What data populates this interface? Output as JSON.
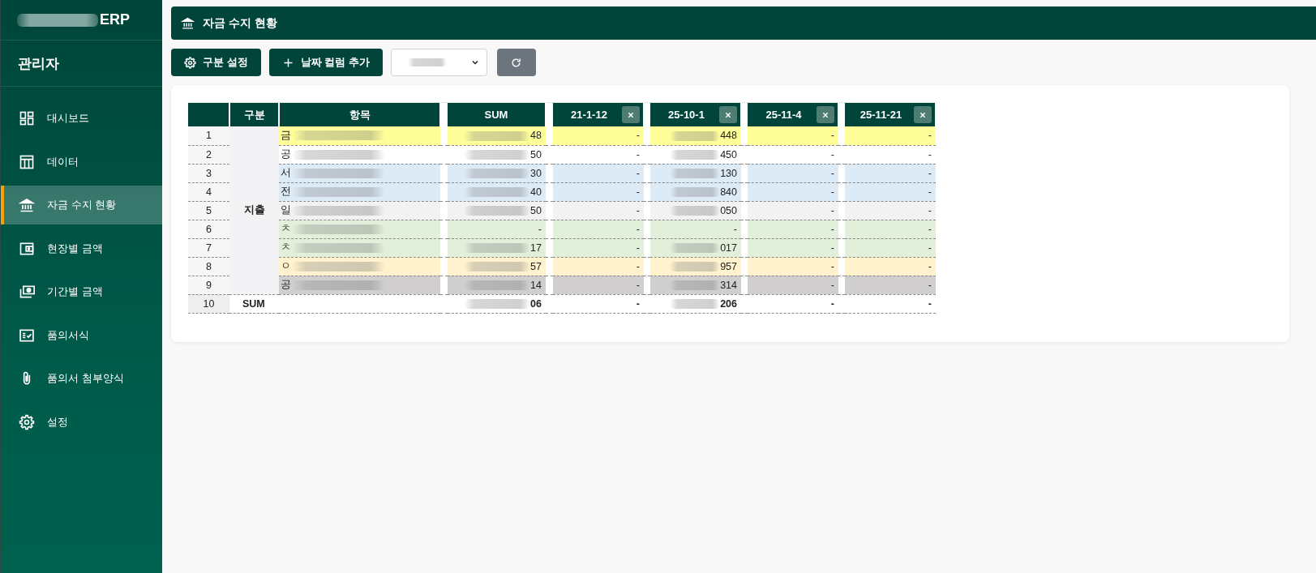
{
  "sidebar": {
    "brand": "ERP",
    "user": "관리자",
    "items": [
      {
        "label": "대시보드",
        "selected": false
      },
      {
        "label": "데이터",
        "selected": false
      },
      {
        "label": "자금 수지 현황",
        "selected": true
      },
      {
        "label": "현장별 금액",
        "selected": false
      },
      {
        "label": "기간별 금액",
        "selected": false
      },
      {
        "label": "품의서식",
        "selected": false
      },
      {
        "label": "품의서 첨부양식",
        "selected": false
      },
      {
        "label": "설정",
        "selected": false
      }
    ]
  },
  "header": {
    "title": "자금 수지 현황"
  },
  "toolbar": {
    "buttons": [
      {
        "kind": "settings",
        "label": "구분 설정"
      },
      {
        "kind": "add",
        "label": "날짜 컬럼 추가"
      }
    ]
  },
  "table": {
    "columns": [
      "구분",
      "항목",
      "SUM"
    ],
    "date_columns": [
      "21-1-12",
      "25-10-1",
      "25-11-4",
      "25-11-21"
    ],
    "group": "지출",
    "rows": [
      {
        "number": "1",
        "color": "#ffff99",
        "item": {
          "text": "금",
          "blurred": true
        },
        "sum": {
          "text": "48",
          "blurred": true
        },
        "values": [
          {
            "text": "-",
            "blurred": false
          },
          {
            "text": "448",
            "blurred": true
          },
          {
            "text": "-",
            "blurred": false
          },
          {
            "text": "-",
            "blurred": false
          }
        ]
      },
      {
        "number": "2",
        "color": "#ffffff",
        "item": {
          "text": "공",
          "blurred": true
        },
        "sum": {
          "text": "50",
          "blurred": true
        },
        "values": [
          {
            "text": "-",
            "blurred": false
          },
          {
            "text": "450",
            "blurred": true
          },
          {
            "text": "-",
            "blurred": false
          },
          {
            "text": "-",
            "blurred": false
          }
        ]
      },
      {
        "number": "3",
        "color": "#ddebf7",
        "item": {
          "text": "서",
          "blurred": true
        },
        "sum": {
          "text": "30",
          "blurred": true
        },
        "values": [
          {
            "text": "-",
            "blurred": false
          },
          {
            "text": "130",
            "blurred": true
          },
          {
            "text": "-",
            "blurred": false
          },
          {
            "text": "-",
            "blurred": false
          }
        ]
      },
      {
        "number": "4",
        "color": "#ddebf7",
        "item": {
          "text": "전",
          "blurred": true
        },
        "sum": {
          "text": "40",
          "blurred": true
        },
        "values": [
          {
            "text": "-",
            "blurred": false
          },
          {
            "text": "840",
            "blurred": true
          },
          {
            "text": "-",
            "blurred": false
          },
          {
            "text": "-",
            "blurred": false
          }
        ]
      },
      {
        "number": "5",
        "color": "#f2f2f2",
        "item": {
          "text": "일",
          "blurred": true
        },
        "sum": {
          "text": "50",
          "blurred": true
        },
        "values": [
          {
            "text": "-",
            "blurred": false
          },
          {
            "text": "050",
            "blurred": true
          },
          {
            "text": "-",
            "blurred": false
          },
          {
            "text": "-",
            "blurred": false
          }
        ]
      },
      {
        "number": "6",
        "color": "#e2efda",
        "item": {
          "text": "ㅊ",
          "blurred": true
        },
        "sum": {
          "text": "-",
          "blurred": false
        },
        "values": [
          {
            "text": "-",
            "blurred": false
          },
          {
            "text": "-",
            "blurred": false
          },
          {
            "text": "-",
            "blurred": false
          },
          {
            "text": "-",
            "blurred": false
          }
        ]
      },
      {
        "number": "7",
        "color": "#e2efda",
        "item": {
          "text": "ㅊ",
          "blurred": true
        },
        "sum": {
          "text": "17",
          "blurred": true
        },
        "values": [
          {
            "text": "-",
            "blurred": false
          },
          {
            "text": "017",
            "blurred": true
          },
          {
            "text": "-",
            "blurred": false
          },
          {
            "text": "-",
            "blurred": false
          }
        ]
      },
      {
        "number": "8",
        "color": "#fff2cc",
        "item": {
          "text": "ㅇ",
          "blurred": true
        },
        "sum": {
          "text": "57",
          "blurred": true
        },
        "values": [
          {
            "text": "-",
            "blurred": false
          },
          {
            "text": "957",
            "blurred": true
          },
          {
            "text": "-",
            "blurred": false
          },
          {
            "text": "-",
            "blurred": false
          }
        ]
      },
      {
        "number": "9",
        "color": "#d0cece",
        "item": {
          "text": "공",
          "blurred": true
        },
        "sum": {
          "text": "14",
          "blurred": true
        },
        "values": [
          {
            "text": "-",
            "blurred": false
          },
          {
            "text": "314",
            "blurred": true
          },
          {
            "text": "-",
            "blurred": false
          },
          {
            "text": "-",
            "blurred": false
          }
        ]
      }
    ],
    "total": {
      "number": "10",
      "label": "SUM",
      "sum": {
        "text": "06",
        "blurred": true
      },
      "values": [
        {
          "text": "-",
          "blurred": false
        },
        {
          "text": "206",
          "blurred": true
        },
        {
          "text": "-",
          "blurred": false
        },
        {
          "text": "-",
          "blurred": false
        }
      ]
    }
  }
}
